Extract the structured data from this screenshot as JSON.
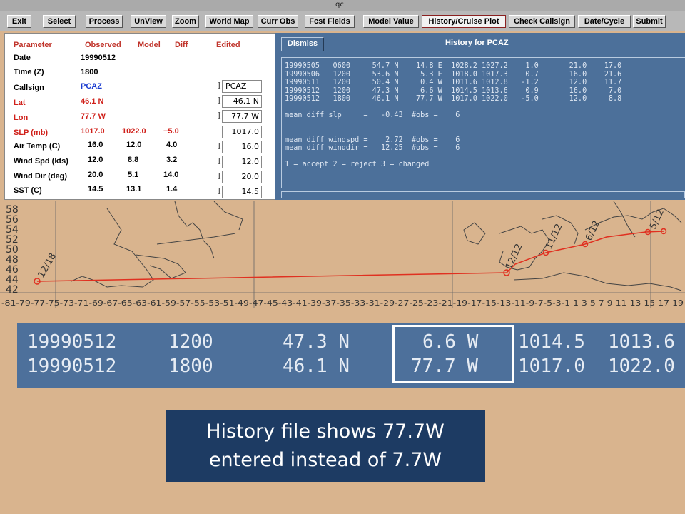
{
  "window": {
    "title": "qc"
  },
  "toolbar": {
    "buttons": [
      "Exit",
      "Select",
      "Process",
      "UnView",
      "Zoom",
      "World Map",
      "Curr Obs",
      "Fcst Fields",
      "Model Value",
      "History/Cruise Plot",
      "Check Callsign",
      "Date/Cycle",
      "Submit"
    ],
    "active": "History/Cruise Plot"
  },
  "params": {
    "headers": {
      "parameter": "Parameter",
      "observed": "Observed",
      "model": "Model",
      "diff": "Diff",
      "edited": "Edited"
    },
    "rows": [
      {
        "label": "Date",
        "observed": "19990512",
        "model": "",
        "diff": "",
        "edited": ""
      },
      {
        "label": "Time (Z)",
        "observed": "1800",
        "model": "",
        "diff": "",
        "edited": ""
      },
      {
        "label": "Callsign",
        "observed": "PCAZ",
        "model": "",
        "diff": "",
        "edited": "PCAZ"
      },
      {
        "label": "Lat",
        "observed": "46.1 N",
        "model": "",
        "diff": "",
        "edited": "46.1 N"
      },
      {
        "label": "Lon",
        "observed": "77.7 W",
        "model": "",
        "diff": "",
        "edited": "77.7 W"
      },
      {
        "label": "SLP (mb)",
        "observed": "1017.0",
        "model": "1022.0",
        "diff": "−5.0",
        "edited": "1017.0"
      },
      {
        "label": "Air Temp (C)",
        "observed": "16.0",
        "model": "12.0",
        "diff": "4.0",
        "edited": "16.0"
      },
      {
        "label": "Wind Spd (kts)",
        "observed": "12.0",
        "model": "8.8",
        "diff": "3.2",
        "edited": "12.0"
      },
      {
        "label": "Wind Dir (deg)",
        "observed": "20.0",
        "model": "5.1",
        "diff": "14.0",
        "edited": "20.0"
      },
      {
        "label": "SST (C)",
        "observed": "14.5",
        "model": "13.1",
        "diff": "1.4",
        "edited": "14.5"
      }
    ]
  },
  "history": {
    "dismiss": "Dismiss",
    "title": "History for PCAZ",
    "lines": [
      "19990505   0600     54.7 N    14.8 E  1028.2 1027.2    1.0       21.0    17.0",
      "19990506   1200     53.6 N     5.3 E  1018.0 1017.3    0.7       16.0    21.6",
      "19990511   1200     50.4 N     0.4 W  1011.6 1012.8   -1.2       12.0    11.7",
      "19990512   1200     47.3 N     6.6 W  1014.5 1013.6    0.9       16.0     7.0",
      "19990512   1800     46.1 N    77.7 W  1017.0 1022.0   -5.0       12.0     8.8",
      "",
      "mean diff slp     =   -0.43  #obs =    6",
      "",
      "",
      "mean diff windspd =    2.72  #obs =    6",
      "mean diff winddir =   12.25  #obs =    6",
      "",
      "1 = accept 2 = reject 3 = changed"
    ]
  },
  "map": {
    "lat_labels": [
      "58",
      "56",
      "54",
      "52",
      "50",
      "48",
      "46",
      "44",
      "42"
    ],
    "lon_axis_text": "-81-79-77-75-73-71-69-67-65-63-61-59-57-55-53-51-49-47-45-43-41-39-37-35-33-31-29-27-25-23-21-19-17-15-13-11-9-7-5-3-1 1 3 5 7 9 11 13 15 17 19",
    "track_labels": [
      "12/18",
      "12/12",
      "11/12",
      "6/12",
      "5/12"
    ]
  },
  "zoom": {
    "rows": [
      [
        "19990512",
        "1200",
        "47.3 N",
        "6.6 W",
        "1014.5",
        "1013.6"
      ],
      [
        "19990512",
        "1800",
        "46.1 N",
        "77.7 W",
        "1017.0",
        "1022.0"
      ]
    ]
  },
  "callout": {
    "line1": "History file shows 77.7W",
    "line2": "entered instead of  7.7W"
  },
  "colors": {
    "panel_blue": "#4c709a",
    "map_tan": "#d9b48e",
    "track_red": "#e03020",
    "callout_navy": "#1d3b63",
    "label_red": "#d0201a"
  }
}
